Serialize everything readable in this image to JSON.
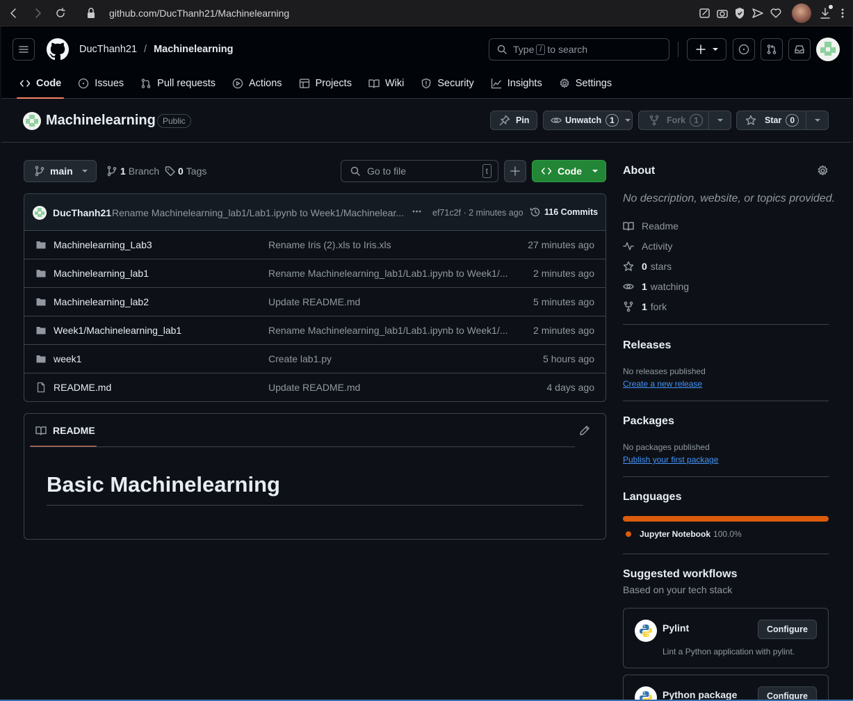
{
  "browser": {
    "url": "github.com/DucThanh21/Machinelearning"
  },
  "header": {
    "owner": "DucThanh21",
    "separator": "/",
    "repo": "Machinelearning",
    "search_prefix": "Type",
    "search_key": "/",
    "search_suffix": "to search"
  },
  "tabs": [
    {
      "label": "Code",
      "icon": "code-icon"
    },
    {
      "label": "Issues",
      "icon": "issue-icon"
    },
    {
      "label": "Pull requests",
      "icon": "pull-request-icon"
    },
    {
      "label": "Actions",
      "icon": "play-icon"
    },
    {
      "label": "Projects",
      "icon": "table-icon"
    },
    {
      "label": "Wiki",
      "icon": "book-icon"
    },
    {
      "label": "Security",
      "icon": "shield-icon"
    },
    {
      "label": "Insights",
      "icon": "graph-icon"
    },
    {
      "label": "Settings",
      "icon": "gear-icon"
    }
  ],
  "repo": {
    "name": "Machinelearning",
    "visibility": "Public",
    "pin_label": "Pin",
    "unwatch_label": "Unwatch",
    "watch_count": "1",
    "fork_label": "Fork",
    "fork_count": "1",
    "star_label": "Star",
    "star_count": "0"
  },
  "toolbar": {
    "branch": "main",
    "branch_count": "1",
    "branch_label": "Branch",
    "tag_count": "0",
    "tag_label": "Tags",
    "goto_placeholder": "Go to file",
    "goto_key": "t",
    "code_label": "Code"
  },
  "commit": {
    "author": "DucThanh21",
    "message": "Rename Machinelearning_lab1/Lab1.ipynb to Week1/Machinelear...",
    "sha_time": "ef71c2f · 2 minutes ago",
    "commits_label": "116 Commits"
  },
  "files": [
    {
      "name": "Machinelearning_Lab3",
      "type": "folder",
      "message": "Rename Iris (2).xls to Iris.xls",
      "time": "27 minutes ago"
    },
    {
      "name": "Machinelearning_lab1",
      "type": "folder",
      "message": "Rename Machinelearning_lab1/Lab1.ipynb to Week1/...",
      "time": "2 minutes ago"
    },
    {
      "name": "Machinelearning_lab2",
      "type": "folder",
      "message": "Update README.md",
      "time": "5 minutes ago"
    },
    {
      "name": "Week1/Machinelearning_lab1",
      "type": "folder",
      "message": "Rename Machinelearning_lab1/Lab1.ipynb to Week1/...",
      "time": "2 minutes ago"
    },
    {
      "name": "week1",
      "type": "folder",
      "message": "Create lab1.py",
      "time": "5 hours ago"
    },
    {
      "name": "README.md",
      "type": "file",
      "message": "Update README.md",
      "time": "4 days ago"
    }
  ],
  "readme": {
    "tab_label": "README",
    "heading": "Basic Machinelearning"
  },
  "about": {
    "title": "About",
    "description": "No description, website, or topics provided.",
    "readme_label": "Readme",
    "activity_label": "Activity",
    "stars_count": "0",
    "stars_label": "stars",
    "watching_count": "1",
    "watching_label": "watching",
    "fork_count": "1",
    "fork_label": "fork"
  },
  "releases": {
    "title": "Releases",
    "empty": "No releases published",
    "link": "Create a new release"
  },
  "packages": {
    "title": "Packages",
    "empty": "No packages published",
    "link": "Publish your first package"
  },
  "languages": {
    "title": "Languages",
    "items": [
      {
        "name": "Jupyter Notebook",
        "percent": "100.0%",
        "fraction": 1.0,
        "color": "#da5b0b"
      }
    ]
  },
  "workflows": {
    "title": "Suggested workflows",
    "subtitle": "Based on your tech stack",
    "items": [
      {
        "name": "Pylint",
        "description": "Lint a Python application with pylint.",
        "button": "Configure"
      },
      {
        "name": "Python package",
        "description": "",
        "button": "Configure"
      }
    ]
  },
  "colors": {
    "accent_underline": "#f78166",
    "code_button": "#238636",
    "link": "#4493f8"
  }
}
